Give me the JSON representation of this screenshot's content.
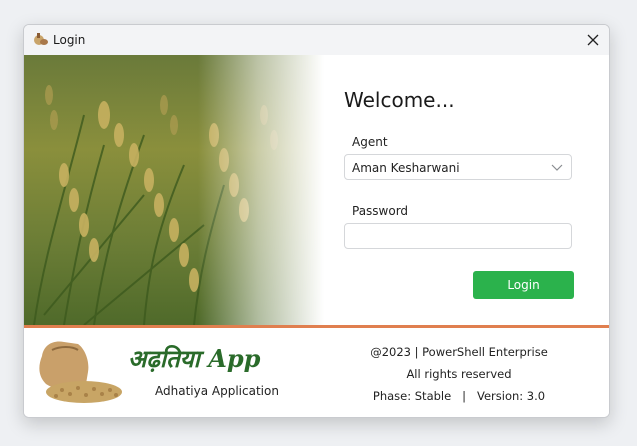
{
  "window": {
    "title": "Login"
  },
  "form": {
    "heading": "Welcome...",
    "agent_label": "Agent",
    "agent_value": "Aman Kesharwani",
    "password_label": "Password",
    "password_value": "",
    "login_label": "Login"
  },
  "footer": {
    "brand": "अढ़तिया App",
    "brand_sub": "Adhatiya Application",
    "copyright": "@2023 | PowerShell Enterprise",
    "rights": "All rights reserved",
    "phase_version": "Phase: Stable   |   Version: 3.0"
  },
  "colors": {
    "accent": "#2bb24c",
    "divider": "#e07f4f",
    "brand": "#2a6b2a"
  },
  "icons": {
    "app": "wheat-sack-icon",
    "close": "close-icon",
    "dropdown": "chevron-down-icon"
  }
}
